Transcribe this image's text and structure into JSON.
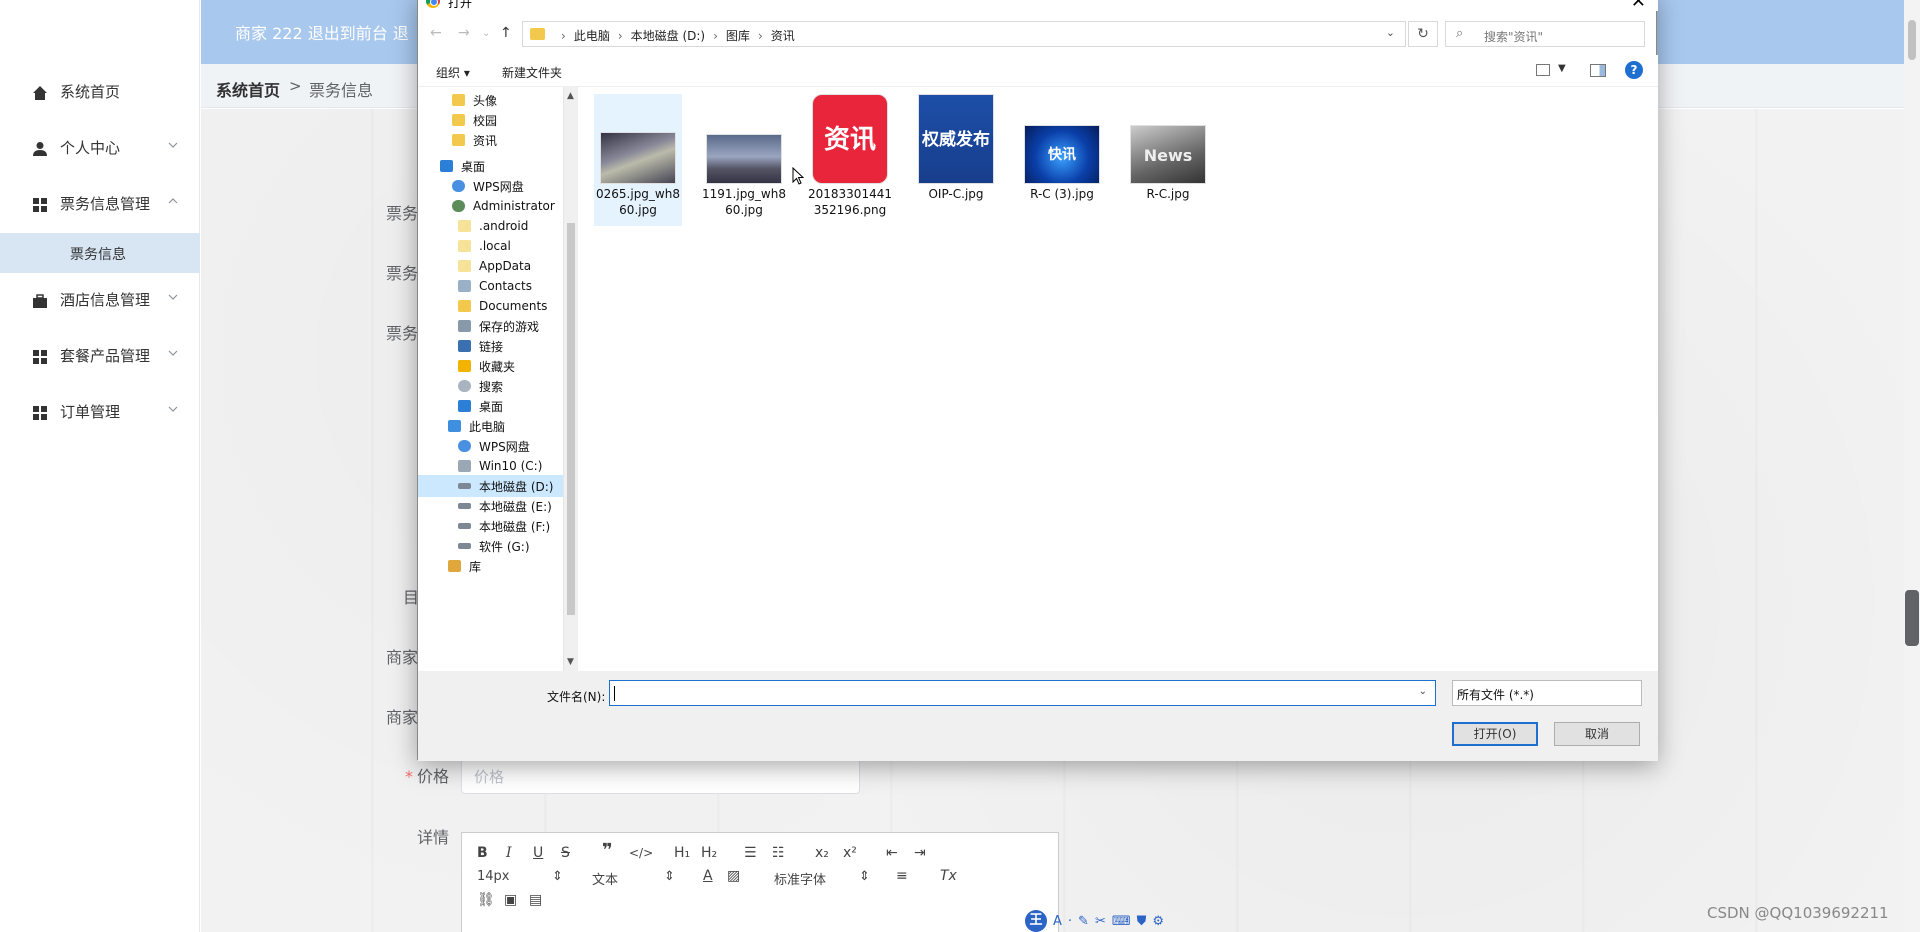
{
  "header": {
    "title": "商家 222  退出到前台  退"
  },
  "breadcrumb": {
    "home": "系统首页",
    "separator": ">",
    "current": "票务信息"
  },
  "sidebar": {
    "items": [
      {
        "label": "系统首页",
        "icon": "home-icon"
      },
      {
        "label": "个人中心",
        "icon": "user-icon"
      },
      {
        "label": "票务信息管理",
        "icon": "grid-icon"
      },
      {
        "label": "票务信息",
        "icon": ""
      },
      {
        "label": "酒店信息管理",
        "icon": "briefcase-icon"
      },
      {
        "label": "套餐产品管理",
        "icon": "grid-icon"
      },
      {
        "label": "订单管理",
        "icon": "grid-icon"
      }
    ]
  },
  "form": {
    "labels": [
      "票务",
      "票务",
      "票务",
      "目",
      "商家",
      "商家",
      "价格",
      "详情"
    ],
    "price_placeholder": "价格"
  },
  "editor": {
    "font_size": "14px",
    "block_type": "文本",
    "font_family": "标准字体"
  },
  "dialog": {
    "title": "打开",
    "close": "✕",
    "address": [
      "此电脑",
      "本地磁盘 (D:)",
      "图库",
      "资讯"
    ],
    "search_placeholder": "搜索\"资讯\"",
    "organize": "组织 ▾",
    "new_folder": "新建文件夹",
    "help": "?",
    "tree": [
      "头像",
      "校园",
      "资讯",
      "桌面",
      "WPS网盘",
      "Administrator",
      ".android",
      ".local",
      "AppData",
      "Contacts",
      "Documents",
      "保存的游戏",
      "链接",
      "收藏夹",
      "搜索",
      "桌面",
      "此电脑",
      "WPS网盘",
      "Win10 (C:)",
      "本地磁盘 (D:)",
      "本地磁盘 (E:)",
      "本地磁盘 (F:)",
      "软件 (G:)",
      "库"
    ],
    "files": [
      {
        "name": "0265.jpg_wh860.jpg"
      },
      {
        "name": "1191.jpg_wh860.jpg"
      },
      {
        "name": "20183301441352196.png"
      },
      {
        "name": "OIP-C.jpg"
      },
      {
        "name": "R-C (3).jpg"
      },
      {
        "name": "R-C.jpg"
      }
    ],
    "thumb_text": {
      "zixun": "资讯",
      "quanwei": "权威发布",
      "news": "News",
      "kuai": "快讯"
    },
    "filename_label": "文件名(N):",
    "filename_value": "",
    "filetype": "所有文件 (*.*)",
    "open_button": "打开(O)",
    "cancel_button": "取消"
  },
  "watermark": "CSDN @QQ1039692211",
  "ime": {
    "logo": "王",
    "letter": "A"
  },
  "colors": {
    "accent": "#1f6fd1",
    "header": "#a8c8ee",
    "submenu_active": "#d8e6f4"
  }
}
